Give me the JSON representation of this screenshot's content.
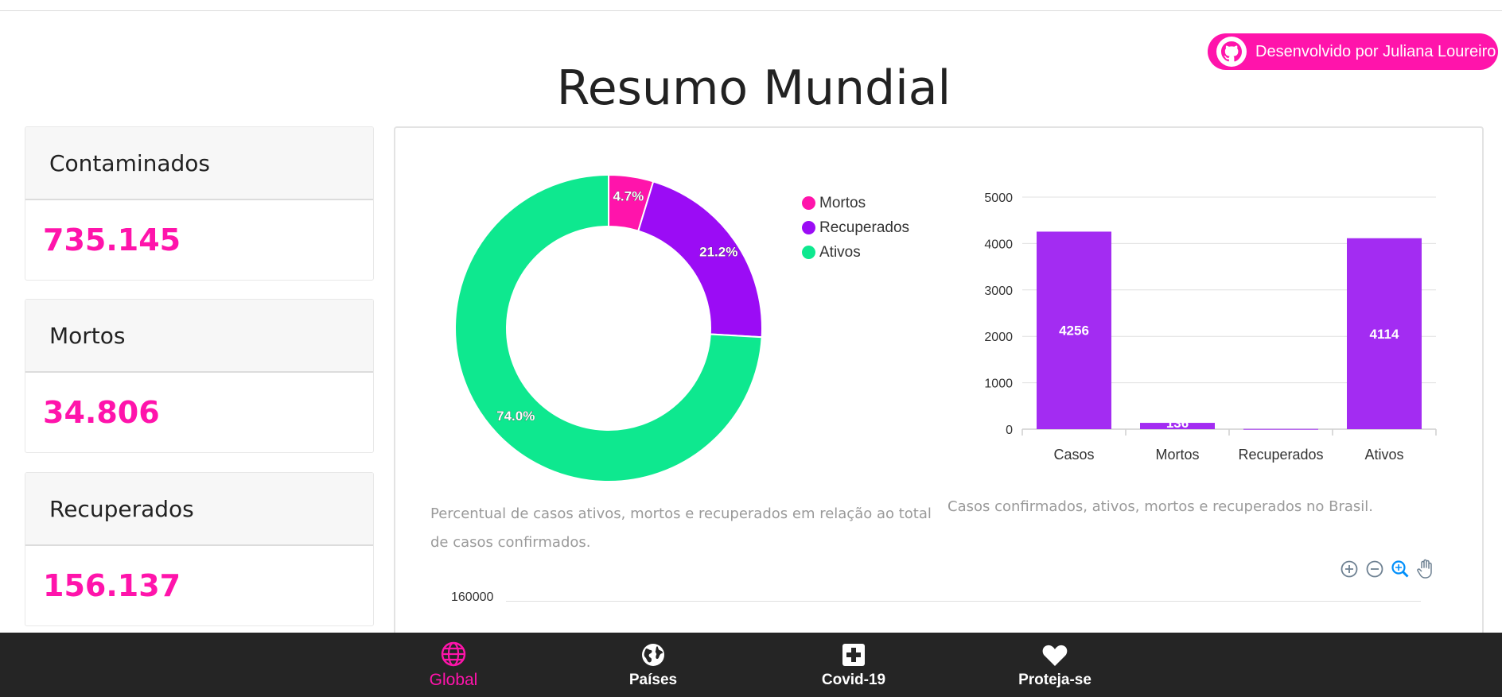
{
  "header": {
    "developer_button": "Desenvolvido por Juliana Loureiro",
    "title": "Resumo Mundial"
  },
  "stats": [
    {
      "label": "Contaminados",
      "value": "735.145"
    },
    {
      "label": "Mortos",
      "value": "34.806"
    },
    {
      "label": "Recuperados",
      "value": "156.137"
    }
  ],
  "colors": {
    "brand": "#ff14ab",
    "mortos": "#ff14ab",
    "recuperados": "#9b0cf5",
    "ativos": "#0ee88f",
    "bars": "#a32cf2"
  },
  "chart_data": [
    {
      "type": "pie",
      "variant": "donut",
      "labels": [
        "Mortos",
        "Recuperados",
        "Ativos"
      ],
      "values": [
        4.7,
        21.2,
        74.0
      ],
      "value_labels": [
        "4.7%",
        "21.2%",
        "74.0%"
      ],
      "legend": [
        "Mortos",
        "Recuperados",
        "Ativos"
      ],
      "legend_position": "right",
      "caption": "Percentual de casos ativos, mortos e recuperados em relação ao total de casos confirmados."
    },
    {
      "type": "bar",
      "categories": [
        "Casos",
        "Mortos",
        "Recuperados",
        "Ativos"
      ],
      "values": [
        4256,
        136,
        6,
        4114
      ],
      "value_labels": [
        "4256",
        "136",
        "",
        "4114"
      ],
      "ylim": [
        0,
        5000
      ],
      "yticks": [
        0,
        1000,
        2000,
        3000,
        4000,
        5000
      ],
      "grid": true,
      "caption": "Casos confirmados, ativos, mortos e recuperados no Brasil."
    },
    {
      "type": "line",
      "yticks_visible": [
        "160000"
      ],
      "toolbar": [
        "zoom-in",
        "zoom-out",
        "zoom-selection",
        "pan"
      ]
    }
  ],
  "nav": [
    {
      "label": "Global",
      "icon": "globe-icon",
      "active": true
    },
    {
      "label": "Países",
      "icon": "earth-icon",
      "active": false
    },
    {
      "label": "Covid-19",
      "icon": "plus-square-icon",
      "active": false
    },
    {
      "label": "Proteja-se",
      "icon": "heart-icon",
      "active": false
    }
  ]
}
